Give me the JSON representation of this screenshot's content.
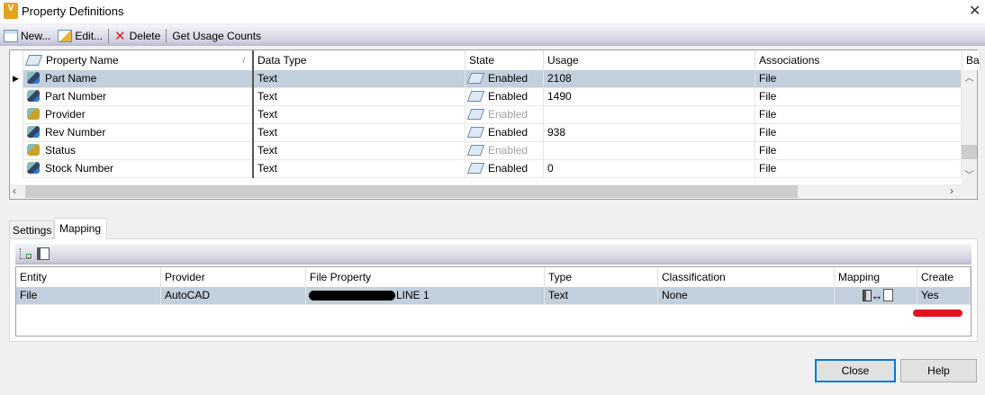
{
  "window": {
    "title": "Property Definitions",
    "app_icon_letter": "V"
  },
  "toolbar": {
    "new": "New...",
    "edit": "Edit...",
    "delete": "Delete",
    "usage": "Get Usage Counts"
  },
  "properties": {
    "columns": [
      "Property Name",
      "Data Type",
      "State",
      "Usage",
      "Associations",
      "Ba"
    ],
    "rows": [
      {
        "name": "Part Name",
        "type": "Text",
        "state": "Enabled",
        "usage": "2108",
        "assoc": "File",
        "enabled": true
      },
      {
        "name": "Part Number",
        "type": "Text",
        "state": "Enabled",
        "usage": "1490",
        "assoc": "File",
        "enabled": true
      },
      {
        "name": "Provider",
        "type": "Text",
        "state": "Enabled",
        "usage": "",
        "assoc": "File",
        "enabled": false
      },
      {
        "name": "Rev Number",
        "type": "Text",
        "state": "Enabled",
        "usage": "938",
        "assoc": "File",
        "enabled": true
      },
      {
        "name": "Status",
        "type": "Text",
        "state": "Enabled",
        "usage": "",
        "assoc": "File",
        "enabled": false
      },
      {
        "name": "Stock Number",
        "type": "Text",
        "state": "Enabled",
        "usage": "0",
        "assoc": "File",
        "enabled": true
      }
    ]
  },
  "tabs": {
    "settings": "Settings",
    "mapping": "Mapping"
  },
  "mapping": {
    "columns": [
      "Entity",
      "Provider",
      "File Property",
      "Type",
      "Classification",
      "Mapping",
      "Create"
    ],
    "row": {
      "entity": "File",
      "provider": "AutoCAD",
      "file_property": "LINE 1",
      "type": "Text",
      "classification": "None",
      "create": "Yes"
    }
  },
  "buttons": {
    "close": "Close",
    "help": "Help"
  },
  "colors": {
    "selection": "#c2cfdc",
    "annotation": "#e0141e"
  }
}
